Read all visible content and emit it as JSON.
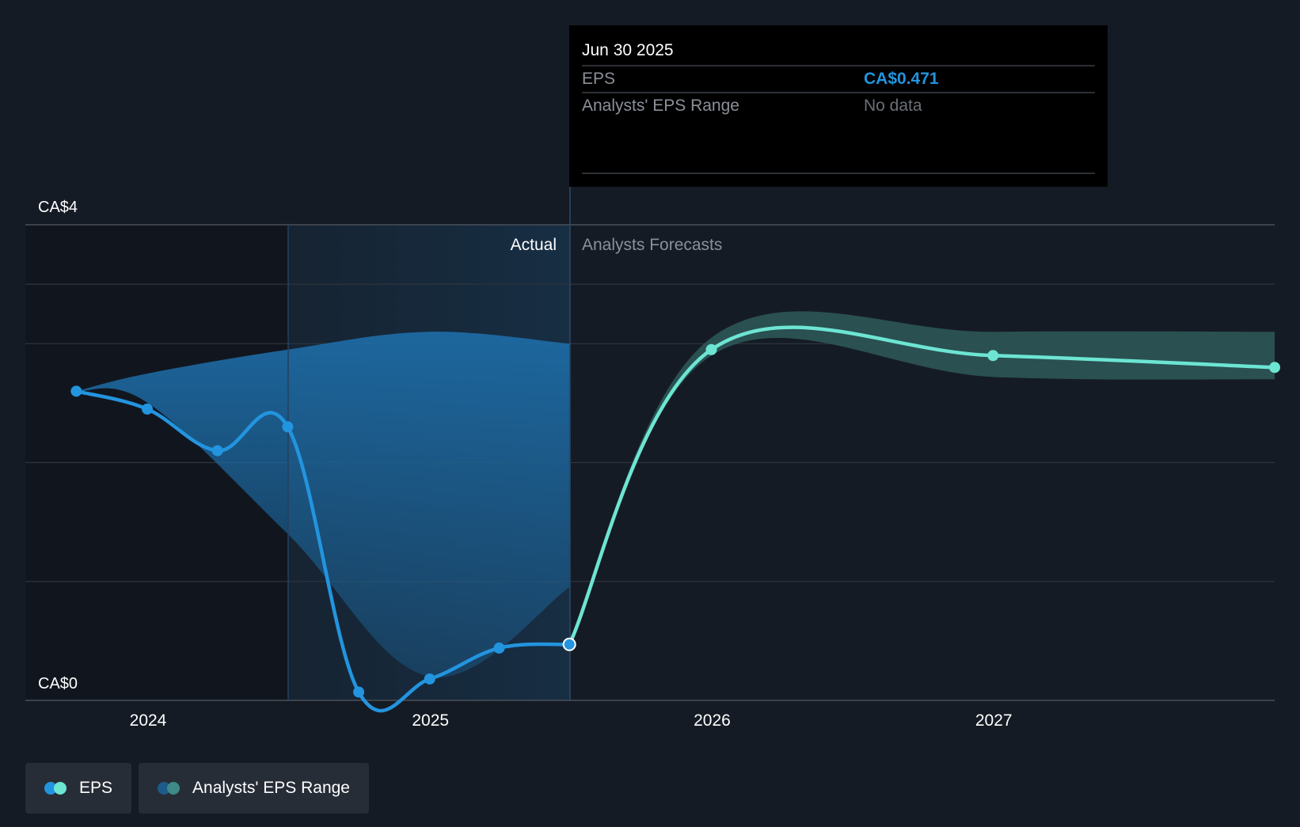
{
  "tooltip": {
    "date": "Jun 30 2025",
    "rows": [
      {
        "label": "EPS",
        "value": "CA$0.471",
        "value_color": "#2394df"
      },
      {
        "label": "Analysts' EPS Range",
        "value": "No data",
        "value_color": "#6b7078"
      }
    ]
  },
  "regions": {
    "actual_label": "Actual",
    "forecast_label": "Analysts Forecasts"
  },
  "colors": {
    "background": "#151b24",
    "actual_line": "#2394df",
    "forecast_line": "#6de5d3",
    "forecast_band": "#2e5959",
    "actual_band": "#1d6aa3",
    "grid": "#2e343d",
    "axis_text": "#ffffff"
  },
  "legend": [
    {
      "label": "EPS",
      "icon": "eps-dots-icon",
      "colors": [
        "#2394df",
        "#6de5d3"
      ]
    },
    {
      "label": "Analysts' EPS Range",
      "icon": "range-dots-icon",
      "colors": [
        "#1d5b8a",
        "#3e8a86"
      ]
    }
  ],
  "chart_data": {
    "type": "line",
    "x_axis": {
      "type": "date",
      "ticks": [
        "2024",
        "2025",
        "2026",
        "2027"
      ],
      "range": [
        "2023-07-01",
        "2027-12-31"
      ]
    },
    "y_axis": {
      "ticks": [
        "CA$0",
        "CA$4"
      ],
      "tick_values": [
        0,
        4
      ],
      "range": [
        0,
        4
      ],
      "gridlines": [
        0,
        1,
        2,
        3,
        3.5,
        4
      ]
    },
    "highlight_date": "2025-06-30",
    "series": [
      {
        "name": "EPS",
        "segment": "actual",
        "points": [
          {
            "x": "2023-09-30",
            "y": 2.6
          },
          {
            "x": "2023-12-31",
            "y": 2.45
          },
          {
            "x": "2024-03-31",
            "y": 2.1
          },
          {
            "x": "2024-06-30",
            "y": 2.3
          },
          {
            "x": "2024-09-30",
            "y": 0.07
          },
          {
            "x": "2024-12-31",
            "y": 0.18
          },
          {
            "x": "2025-03-31",
            "y": 0.44
          },
          {
            "x": "2025-06-30",
            "y": 0.471
          }
        ]
      },
      {
        "name": "EPS",
        "segment": "forecast",
        "points": [
          {
            "x": "2025-06-30",
            "y": 0.471
          },
          {
            "x": "2025-12-31",
            "y": 2.95
          },
          {
            "x": "2026-12-31",
            "y": 2.9
          },
          {
            "x": "2027-12-31",
            "y": 2.8
          }
        ]
      },
      {
        "name": "Analysts' EPS Range",
        "segment": "forecast",
        "band": [
          {
            "x": "2025-06-30",
            "low": 0.471,
            "high": 0.471
          },
          {
            "x": "2025-12-31",
            "low": 2.9,
            "high": 3.05
          },
          {
            "x": "2026-12-31",
            "low": 2.72,
            "high": 3.1
          },
          {
            "x": "2027-12-31",
            "low": 2.7,
            "high": 3.1
          }
        ]
      }
    ],
    "actual_band": [
      {
        "x": "2023-09-30",
        "low": 2.6,
        "high": 2.6
      },
      {
        "x": "2024-01-01",
        "low": 2.5,
        "high": 2.75
      },
      {
        "x": "2024-06-30",
        "low": 1.4,
        "high": 2.95
      },
      {
        "x": "2024-12-31",
        "low": 0.2,
        "high": 3.1
      },
      {
        "x": "2025-06-30",
        "low": 0.95,
        "high": 3.0
      }
    ]
  }
}
